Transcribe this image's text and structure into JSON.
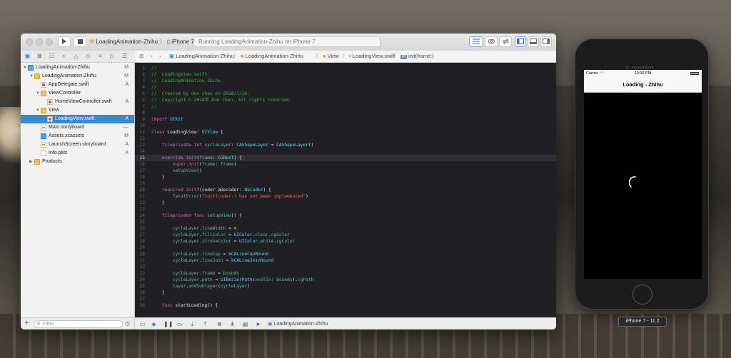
{
  "toolbar": {
    "scheme_project": "LoadingAnimation-Zhihu",
    "scheme_device": "iPhone 7",
    "activity": "Running LoadingAnimation-Zhihu on iPhone 7",
    "run_icon": "play-icon",
    "stop_icon": "stop-icon"
  },
  "navigator": {
    "items": [
      {
        "label": "LoadingAnimation-Zhihu",
        "badge": "M"
      },
      {
        "label": "LoadingAnimation-Zhihu",
        "badge": "M"
      },
      {
        "label": "AppDelegate.swift",
        "badge": "A"
      },
      {
        "label": "ViewController",
        "badge": ""
      },
      {
        "label": "HomeViewController.swift",
        "badge": "A"
      },
      {
        "label": "View",
        "badge": ""
      },
      {
        "label": "LoadingView.swift",
        "badge": "A"
      },
      {
        "label": "Main.storyboard",
        "badge": "—"
      },
      {
        "label": "Assets.xcassets",
        "badge": "M"
      },
      {
        "label": "LaunchScreen.storyboard",
        "badge": "A"
      },
      {
        "label": "Info.plist",
        "badge": "A"
      },
      {
        "label": "Products",
        "badge": ""
      }
    ],
    "filter_placeholder": "Filter"
  },
  "jumpbar": {
    "crumbs": [
      "LoadingAnimation-Zhihu",
      "LoadingAnimation-Zhihu",
      "View",
      "LoadingView.swift",
      "init(frame:)"
    ],
    "method_badge": "M"
  },
  "editor": {
    "current_line": 15,
    "lines": [
      "//",
      "//  LoadingView.swift",
      "//  LoadingAnimation-Zhihu",
      "//",
      "//  Created by don chen on 2018/1/14.",
      "//  Copyright © 2018年 Don Chen. All rights reserved.",
      "//",
      "",
      "import UIKit",
      "",
      "class LoadingView: UIView {",
      "",
      "    fileprivate let cycleLayer: CAShapeLayer = CAShapeLayer()",
      "",
      "    override init(frame: CGRect) {",
      "        super.init(frame: frame)",
      "        setupView()",
      "    }",
      "",
      "    required init?(coder aDecoder: NSCoder) {",
      "        fatalError(\"init(coder:) has not been implemented\")",
      "    }",
      "",
      "    fileprivate func setupView() {",
      "",
      "        cycleLayer.lineWidth = 4",
      "        cycleLayer.fillColor = UIColor.clear.cgColor",
      "        cycleLayer.strokeColor = UIColor.white.cgColor",
      "",
      "        cycleLayer.lineCap = kCALineCapRound",
      "        cycleLayer.lineJoin = kCALineJoinRound",
      "",
      "        cycleLayer.frame = bounds",
      "        cycleLayer.path = UIBezierPath(ovalIn: bounds).cgPath",
      "        layer.addSublayer(cycleLayer)",
      "    }",
      "",
      "    func startLoading() {"
    ]
  },
  "debugbar": {
    "target": "LoadingAnimation-Zhihu"
  },
  "simulator": {
    "carrier": "Carrier",
    "time": "10:30 PM",
    "nav_title": "Loading - Zhihu",
    "label": "iPhone 7 - 11.2"
  }
}
